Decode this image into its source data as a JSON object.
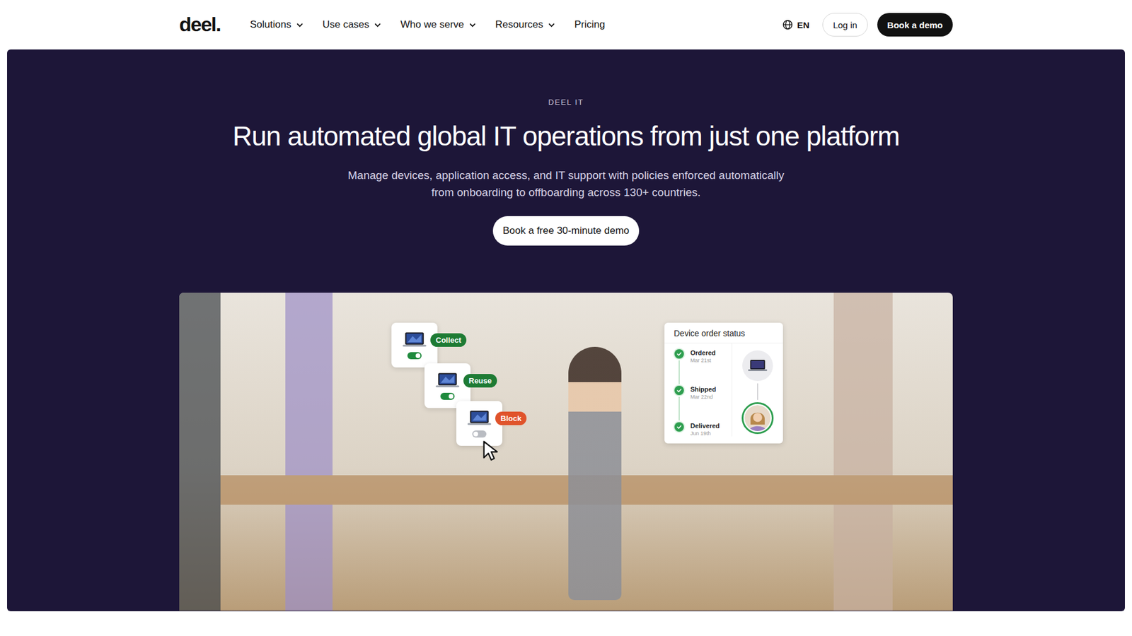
{
  "header": {
    "logo": "deel.",
    "nav": [
      {
        "label": "Solutions",
        "dropdown": true
      },
      {
        "label": "Use cases",
        "dropdown": true
      },
      {
        "label": "Who we serve",
        "dropdown": true
      },
      {
        "label": "Resources",
        "dropdown": true
      },
      {
        "label": "Pricing",
        "dropdown": false
      }
    ],
    "language": "EN",
    "login": "Log in",
    "cta": "Book a demo"
  },
  "hero": {
    "eyebrow": "DEEL IT",
    "title": "Run automated global IT operations from just one platform",
    "subtitle_lines": [
      "Manage devices, application access, and IT support with policies enforced automatically",
      "from onboarding to offboarding across 130+ countries."
    ],
    "button": "Book a free 30-minute demo"
  },
  "device_actions": [
    {
      "label": "Collect",
      "on": true,
      "color": "#1e7b34"
    },
    {
      "label": "Reuse",
      "on": true,
      "color": "#1e7b34"
    },
    {
      "label": "Block",
      "on": false,
      "color": "#e0532b"
    }
  ],
  "order_status": {
    "title": "Device order status",
    "steps": [
      {
        "label": "Ordered",
        "date": "Mar 21st",
        "done": true
      },
      {
        "label": "Shipped",
        "date": "Mar 22nd",
        "done": true
      },
      {
        "label": "Delivered",
        "date": "Jun 19th",
        "done": true
      }
    ]
  }
}
